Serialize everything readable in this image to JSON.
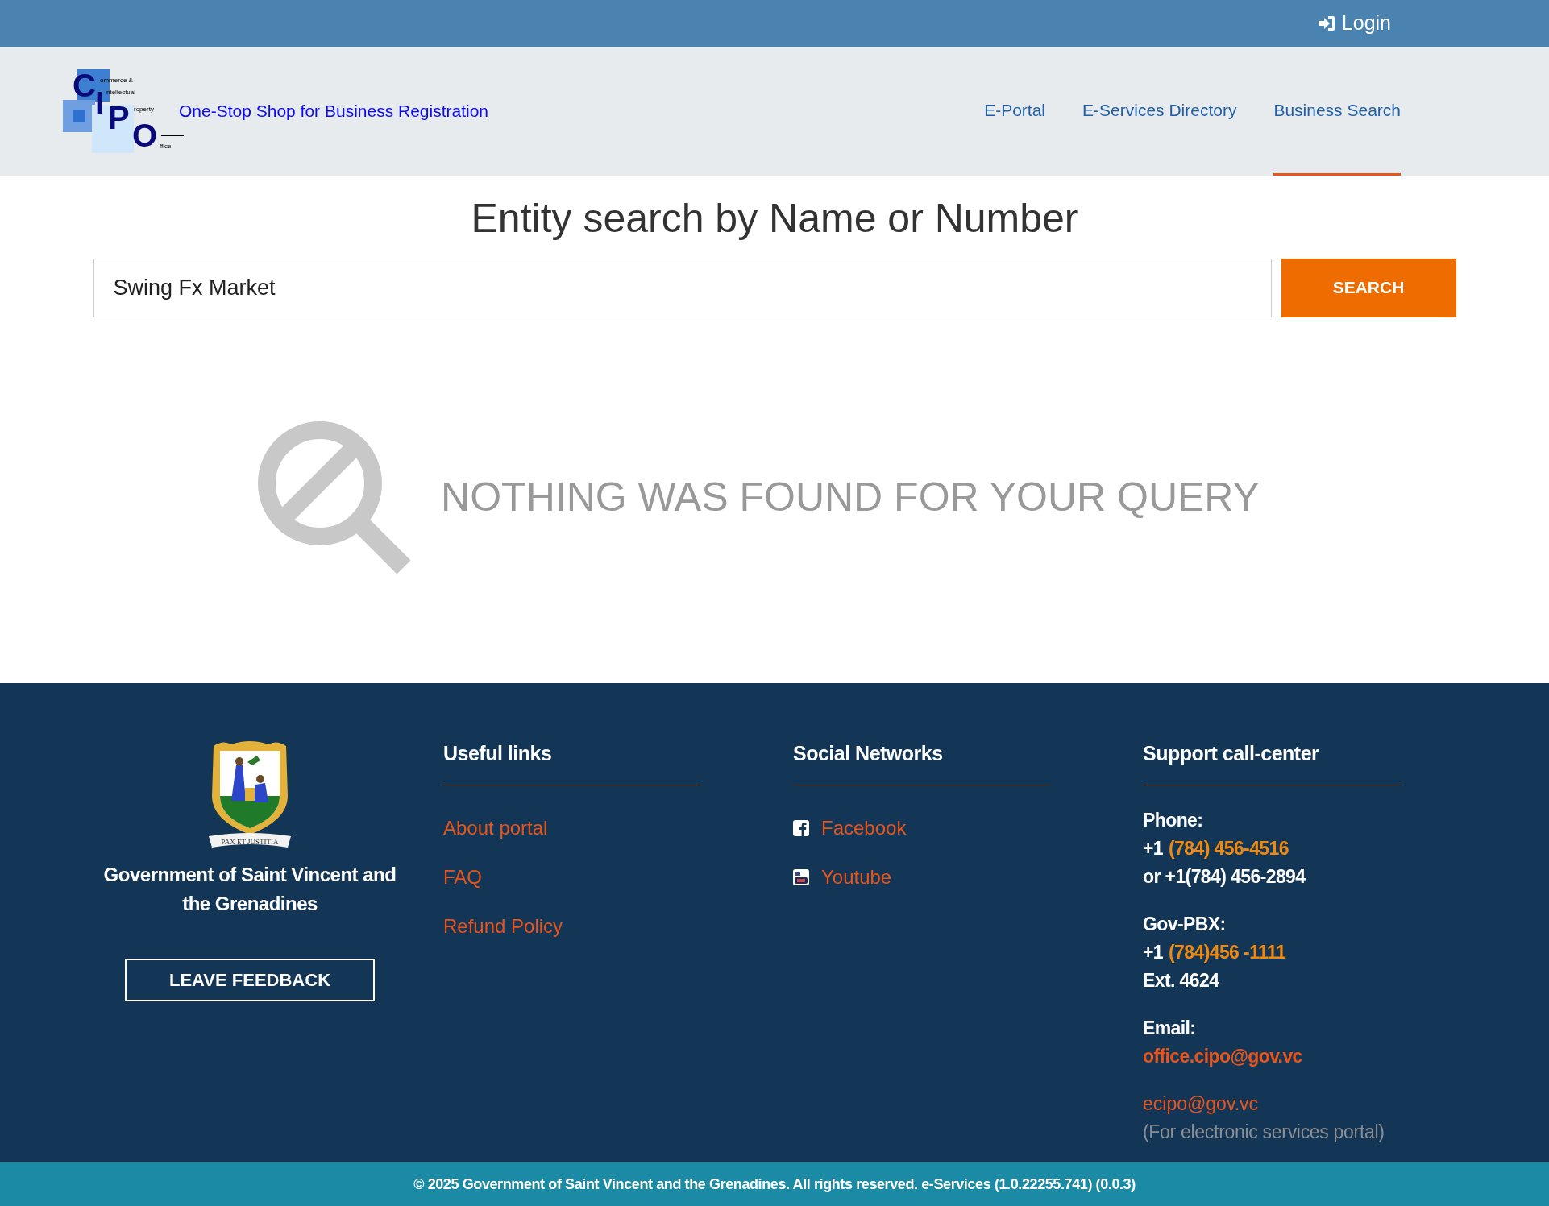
{
  "top_bar": {
    "login": "Login"
  },
  "header": {
    "logo": {
      "letters": [
        "C",
        "I",
        "P",
        "O"
      ],
      "words": [
        "ommerce &",
        "ntellectual",
        "roperty",
        "ffice"
      ]
    },
    "site_title": "One-Stop Shop for Business Registration",
    "nav": [
      {
        "label": "E-Portal",
        "selected": false
      },
      {
        "label": "E-Services Directory",
        "selected": false
      },
      {
        "label": "Business Search",
        "selected": true
      }
    ]
  },
  "search": {
    "title": "Entity search by Name or Number",
    "value": "Swing Fx Market",
    "button": "SEARCH"
  },
  "result": {
    "message": "NOTHING WAS FOUND FOR YOUR QUERY"
  },
  "footer": {
    "emblem_motto": "PAX ET JUSTITIA",
    "government": "Government of Saint Vincent and the Grenadines",
    "feedback_button": "LEAVE FEEDBACK",
    "useful_links": {
      "title": "Useful links",
      "links": [
        "About portal",
        "FAQ",
        "Refund Policy"
      ]
    },
    "social": {
      "title": "Social Networks",
      "links": [
        {
          "label": "Facebook",
          "kind": "facebook"
        },
        {
          "label": "Youtube",
          "kind": "youtube"
        }
      ]
    },
    "support": {
      "title": "Support call-center",
      "groups": [
        {
          "label": "Phone:",
          "lines": [
            {
              "kind": "phone",
              "prefix": "+1",
              "link": "(784) 456-4516"
            },
            {
              "kind": "text",
              "text": "or +1(784) 456-2894"
            }
          ]
        },
        {
          "label": "Gov-PBX:",
          "lines": [
            {
              "kind": "phone",
              "prefix": "+1",
              "link": "(784)456 -1111"
            },
            {
              "kind": "text",
              "text": "Ext. 4624"
            }
          ]
        },
        {
          "label": "Email:",
          "lines": [
            {
              "kind": "email",
              "text": "office.cipo@gov.vc"
            }
          ]
        },
        {
          "lines": [
            {
              "kind": "link",
              "text": "ecipo@gov.vc"
            },
            {
              "kind": "note",
              "text": "(For electronic services portal)"
            }
          ]
        }
      ]
    }
  },
  "copyright": "© 2025 Government of Saint Vincent and the Grenadines. All rights reserved. e-Services (1.0.22255.741) (0.0.3)"
}
